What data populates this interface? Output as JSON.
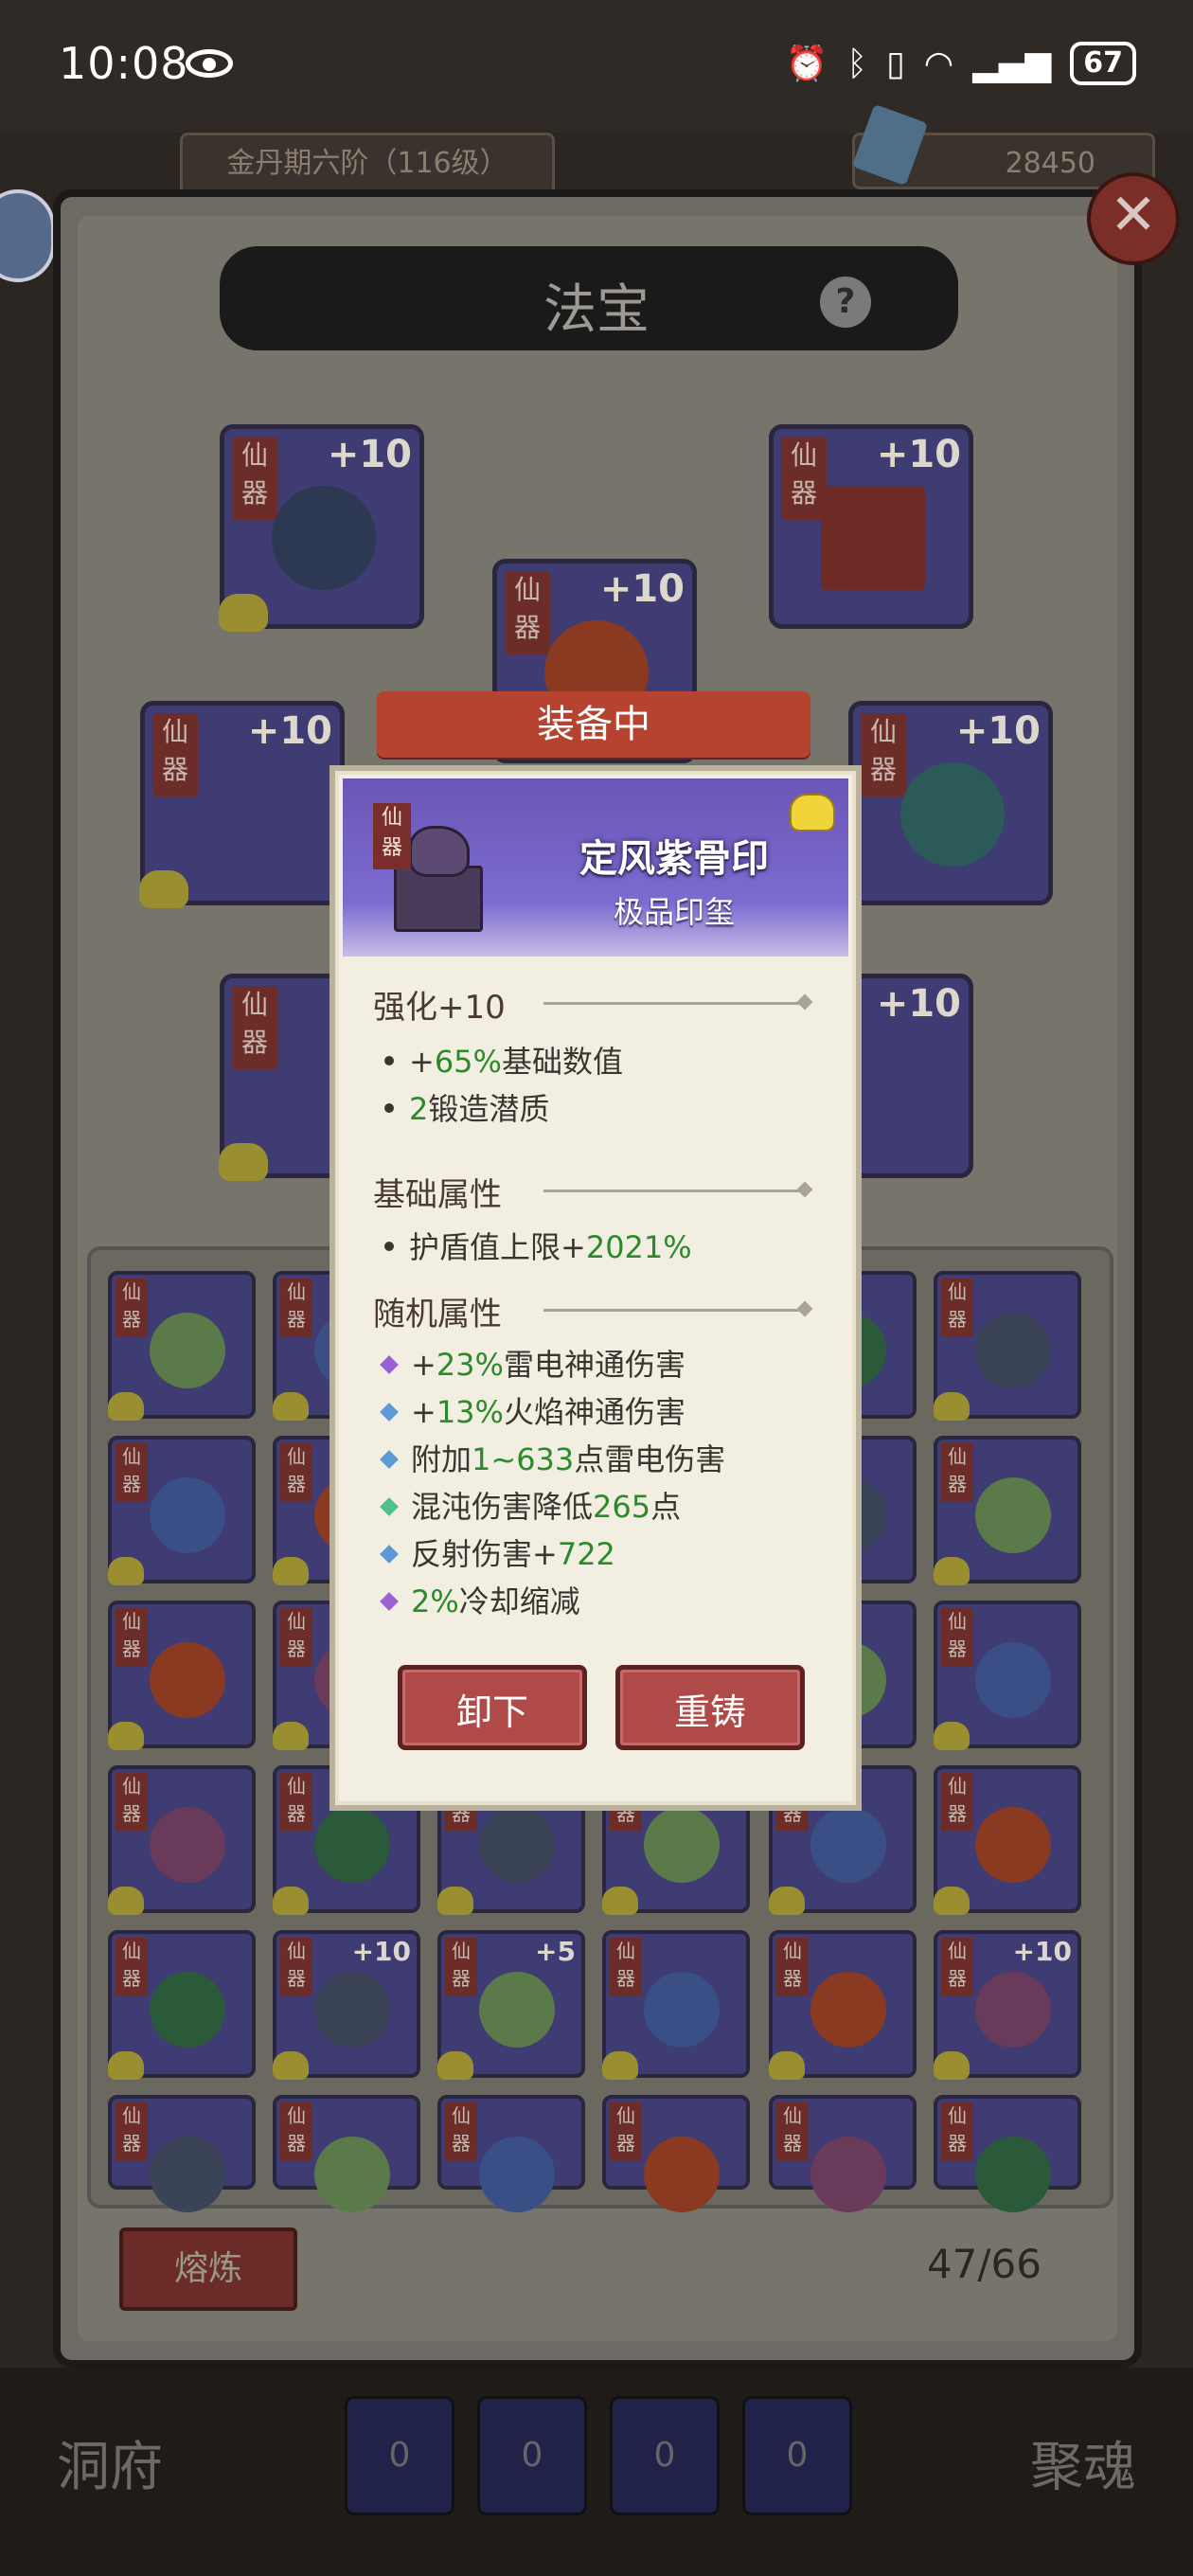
{
  "status": {
    "time": "10:08",
    "battery": "67"
  },
  "header": {
    "realm": "金丹期六阶（116级）",
    "currency": "28450"
  },
  "panel": {
    "title": "法宝",
    "help": "?",
    "close": "✕"
  },
  "slots": [
    {
      "tag": "仙\n器",
      "plus": "+10"
    },
    {
      "tag": "仙\n器",
      "plus": "+10"
    },
    {
      "tag": "仙\n器",
      "plus": "+10"
    },
    {
      "tag": "仙\n器",
      "plus": "+10"
    },
    {
      "tag": "仙\n器",
      "plus": "+10"
    },
    {
      "tag": "仙\n器",
      "plus": ""
    },
    {
      "tag": "仙\n器",
      "plus": "+10"
    }
  ],
  "inventory": {
    "tag": "仙\n器",
    "smelt_label": "熔炼",
    "count": "47/66",
    "plus_badges": [
      "+10",
      "+5",
      "+10"
    ]
  },
  "bottom_nav": {
    "left": "洞府",
    "right": "聚魂",
    "slots": [
      "0",
      "0",
      "0",
      "0"
    ]
  },
  "popup": {
    "equipped_label": "装备中",
    "tag": "仙\n器",
    "name": "定风紫骨印",
    "type": "极品印玺",
    "enhance": {
      "title": "强化+10",
      "lines": [
        {
          "prefix": "+",
          "value": "65%",
          "suffix": "基础数值"
        },
        {
          "prefix": "",
          "value": "2",
          "suffix": "锻造潜质"
        }
      ]
    },
    "base": {
      "title": "基础属性",
      "lines": [
        {
          "prefix": "护盾值上限+",
          "value": "2021%",
          "suffix": ""
        }
      ]
    },
    "random": {
      "title": "随机属性",
      "lines": [
        {
          "color": "#9b5fd6",
          "prefix": "+",
          "value": "23%",
          "suffix": "雷电神通伤害"
        },
        {
          "color": "#5b9ad6",
          "prefix": "+",
          "value": "13%",
          "suffix": "火焰神通伤害"
        },
        {
          "color": "#5b9ad6",
          "prefix": "附加",
          "value": "1~633",
          "suffix": "点雷电伤害"
        },
        {
          "color": "#4fbf8c",
          "prefix": "混沌伤害降低",
          "value": "265",
          "suffix": "点"
        },
        {
          "color": "#5b9ad6",
          "prefix": "反射伤害+",
          "value": "722",
          "suffix": ""
        },
        {
          "color": "#9b5fd6",
          "prefix": "",
          "value": "2%",
          "suffix": "冷却缩减"
        }
      ]
    },
    "buttons": {
      "unequip": "卸下",
      "reforge": "重铸"
    }
  }
}
